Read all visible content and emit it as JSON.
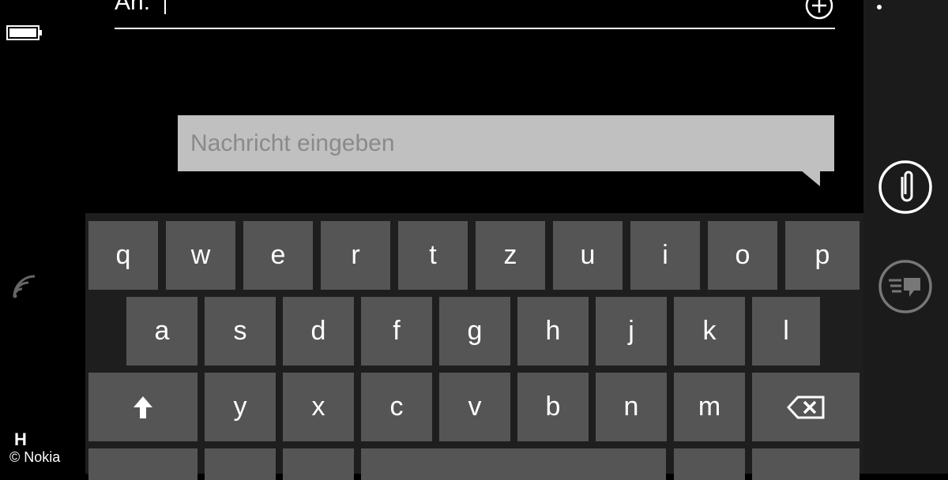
{
  "recipient": {
    "label": "An:"
  },
  "message": {
    "placeholder": "Nachricht eingeben"
  },
  "status": {
    "network": "H"
  },
  "watermark": {
    "text": "© Nokia"
  },
  "icons": {
    "battery": "battery-icon",
    "signal": "wifi-signal-icon",
    "add": "add-circle-icon",
    "attach": "paperclip-icon",
    "voice": "voice-dictation-icon",
    "shift": "shift-arrow-icon",
    "backspace": "backspace-icon"
  },
  "colors": {
    "background": "#000000",
    "key": "#555555",
    "message_box": "#c0c0c0",
    "placeholder": "#8a8a8a",
    "appbar": "#1b1b1b"
  },
  "keyboard": {
    "row1": [
      "q",
      "w",
      "e",
      "r",
      "t",
      "z",
      "u",
      "i",
      "o",
      "p"
    ],
    "row2": [
      "a",
      "s",
      "d",
      "f",
      "g",
      "h",
      "j",
      "k",
      "l"
    ],
    "row3": [
      "y",
      "x",
      "c",
      "v",
      "b",
      "n",
      "m"
    ]
  }
}
